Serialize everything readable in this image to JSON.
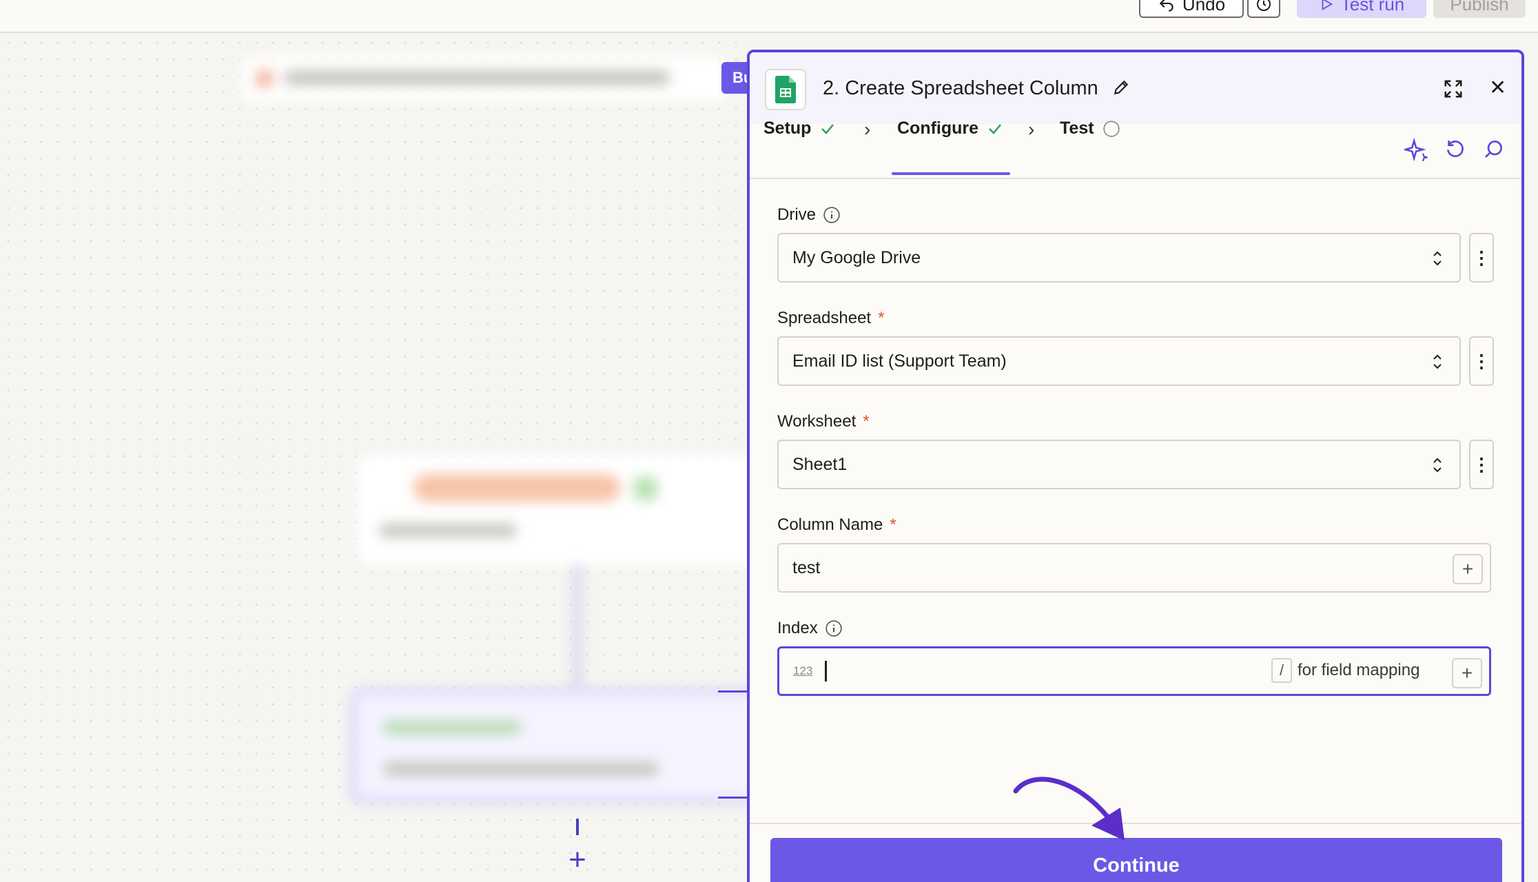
{
  "toolbar": {
    "undo_label": "Undo",
    "test_run_label": "Test run",
    "publish_label": "Publish"
  },
  "canvas": {
    "side_tab_label": "Bu"
  },
  "panel": {
    "title": "2. Create Spreadsheet Column",
    "tabs": [
      {
        "label": "Setup",
        "status": "complete"
      },
      {
        "label": "Configure",
        "status": "complete"
      },
      {
        "label": "Test",
        "status": "pending"
      }
    ],
    "fields": {
      "drive": {
        "label": "Drive",
        "value": "My Google Drive"
      },
      "spreadsheet": {
        "label": "Spreadsheet",
        "required": "*",
        "value": "Email ID list (Support Team)"
      },
      "worksheet": {
        "label": "Worksheet",
        "required": "*",
        "value": "Sheet1"
      },
      "column_name": {
        "label": "Column Name",
        "required": "*",
        "value": "test"
      },
      "index": {
        "label": "Index",
        "type_icon": "123",
        "slash": "/",
        "hint": "for field mapping",
        "value": ""
      }
    },
    "continue_label": "Continue"
  },
  "colors": {
    "accent": "#6c58e6",
    "success": "#2f9e5a",
    "required": "#e0542d"
  },
  "icons": [
    "undo-icon",
    "history-icon",
    "play-icon",
    "google-sheets-icon",
    "pencil-icon",
    "expand-icon",
    "close-icon",
    "check-icon",
    "chevron-right-icon",
    "ai-sparkle-icon",
    "reset-icon",
    "search-icon",
    "info-icon",
    "updown-icon",
    "kebab-icon",
    "plus-icon",
    "annotation-arrow"
  ]
}
